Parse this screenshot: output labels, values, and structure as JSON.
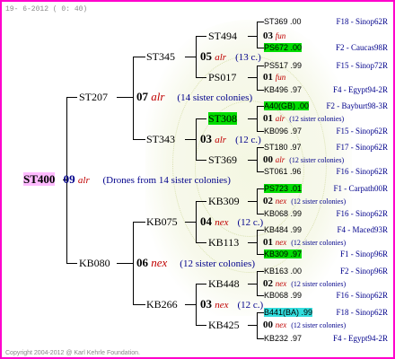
{
  "header": "19- 6-2012 ( 0: 40)",
  "footer": "Copyright 2004-2012 @ Karl Kehrle Foundation.",
  "root": {
    "name": "ST400",
    "gen": "09",
    "queen": "alr",
    "note": "(Drones from 14 sister colonies)"
  },
  "g1": [
    {
      "name": "ST207",
      "gen": "07",
      "queen": "alr",
      "note": "(14 sister colonies)"
    },
    {
      "name": "KB080",
      "gen": "06",
      "queen": "nex",
      "note": "(12 sister colonies)"
    }
  ],
  "g2": [
    {
      "name": "ST345",
      "gen": "05",
      "queen": "alr",
      "note": "(13 c.)"
    },
    {
      "name": "ST343",
      "gen": "03",
      "queen": "alr",
      "note": "(12 c.)"
    },
    {
      "name": "KB075",
      "gen": "04",
      "queen": "nex",
      "note": "(12 c.)"
    },
    {
      "name": "KB266",
      "gen": "03",
      "queen": "nex",
      "note": "(12 c.)"
    }
  ],
  "g3": [
    {
      "name": "ST494",
      "gen": "03",
      "queen": "fun",
      "note": ""
    },
    {
      "name": "PS017",
      "gen": "01",
      "queen": "fun",
      "note": ""
    },
    {
      "name": "ST308",
      "gen": "01",
      "queen": "alr",
      "note": "(12 sister colonies)"
    },
    {
      "name": "ST369",
      "gen": "00",
      "queen": "alr",
      "note": "(12 sister colonies)"
    },
    {
      "name": "KB309",
      "gen": "02",
      "queen": "nex",
      "note": "(12 sister colonies)"
    },
    {
      "name": "KB113",
      "gen": "01",
      "queen": "nex",
      "note": "(12 sister colonies)"
    },
    {
      "name": "KB448",
      "gen": "02",
      "queen": "nex",
      "note": "(12 sister colonies)"
    },
    {
      "name": "KB425",
      "gen": "00",
      "queen": "nex",
      "note": "(12 sister colonies)"
    }
  ],
  "g4": [
    {
      "left": "ST369 .00",
      "right": "F18 - Sinop62R",
      "hl": ""
    },
    {
      "left": "PS672 .00",
      "right": "F2 - Caucas98R",
      "hl": "g"
    },
    {
      "left": "PS517 .99",
      "right": "F15 - Sinop72R",
      "hl": ""
    },
    {
      "left": "KB496 .97",
      "right": "F4 - Egypt94-2R",
      "hl": ""
    },
    {
      "left": "A40(GB) .00",
      "right": "F2 - Bayburt98-3R",
      "hl": "g"
    },
    {
      "left": "KB096 .97",
      "right": "F15 - Sinop62R",
      "hl": ""
    },
    {
      "left": "ST180 .97",
      "right": "F17 - Sinop62R",
      "hl": ""
    },
    {
      "left": "ST061 .96",
      "right": "F16 - Sinop62R",
      "hl": ""
    },
    {
      "left": "PS723 .01",
      "right": "F1 - Carpath00R",
      "hl": "g"
    },
    {
      "left": "KB068 .99",
      "right": "F16 - Sinop62R",
      "hl": ""
    },
    {
      "left": "KB484 .99",
      "right": "F4 - Maced93R",
      "hl": ""
    },
    {
      "left": "KB309 .97",
      "right": "F1 - Sinop96R",
      "hl": "g"
    },
    {
      "left": "KB163 .00",
      "right": "F2 - Sinop96R",
      "hl": ""
    },
    {
      "left": "KB068 .99",
      "right": "F16 - Sinop62R",
      "hl": ""
    },
    {
      "left": "B441(BA) .99",
      "right": "F18 - Sinop62R",
      "hl": "c"
    },
    {
      "left": "KB232 .97",
      "right": "F4 - Egypt94-2R",
      "hl": ""
    }
  ]
}
